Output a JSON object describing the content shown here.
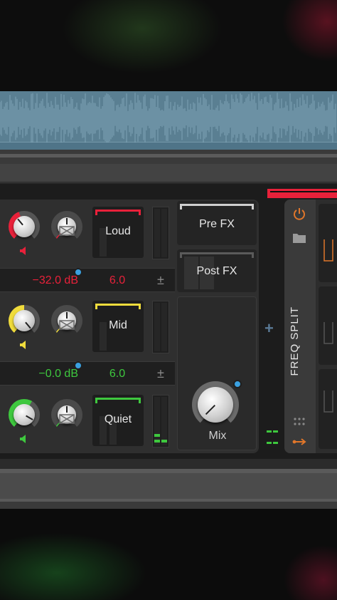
{
  "device": {
    "bands": [
      {
        "name": "Loud",
        "gain": "−32.0 dB",
        "value": "6.0",
        "color": "#e8213a",
        "stepper": "±"
      },
      {
        "name": "Mid",
        "gain": "−0.0 dB",
        "value": "6.0",
        "color": "#f0dc3c",
        "stepper": "±"
      },
      {
        "name": "Quiet",
        "value": "",
        "color": "#3ec83e"
      }
    ],
    "fx": {
      "pre_label": "Pre FX",
      "post_label": "Post FX",
      "mix_label": "Mix"
    }
  },
  "right_device": {
    "title": "FREQ SPLIT",
    "accent": "#e0762a"
  },
  "add_symbol": "+"
}
